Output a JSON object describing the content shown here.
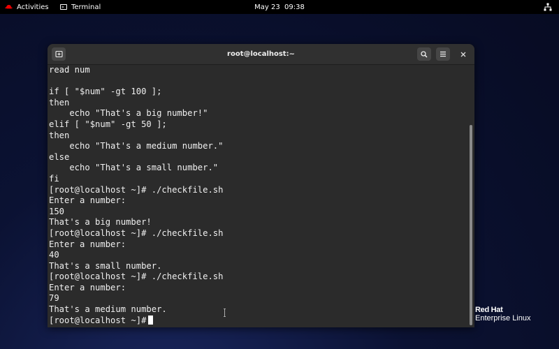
{
  "topbar": {
    "activities": "Activities",
    "app_name": "Terminal",
    "clock": "May 23  09:38"
  },
  "window": {
    "title": "root@localhost:~"
  },
  "terminal_lines": [
    "read num",
    "",
    "if [ \"$num\" -gt 100 ];",
    "then",
    "    echo \"That's a big number!\"",
    "elif [ \"$num\" -gt 50 ];",
    "then",
    "    echo \"That's a medium number.\"",
    "else",
    "    echo \"That's a small number.\"",
    "fi",
    "[root@localhost ~]# ./checkfile.sh",
    "Enter a number:",
    "150",
    "That's a big number!",
    "[root@localhost ~]# ./checkfile.sh",
    "Enter a number:",
    "40",
    "That's a small number.",
    "[root@localhost ~]# ./checkfile.sh",
    "Enter a number:",
    "79",
    "That's a medium number."
  ],
  "prompt": "[root@localhost ~]#",
  "branding": {
    "line1": "Red Hat",
    "line2": "Enterprise Linux"
  },
  "icons": {
    "new_tab": "new-tab-icon",
    "search": "search-icon",
    "menu": "hamburger-menu-icon",
    "close": "close-icon",
    "system": "network-icon"
  },
  "colors": {
    "topbar": "#000000",
    "terminal_bg": "#2b2b2b",
    "header_bg": "#303030",
    "text": "#f0f0f0",
    "redhat_red": "#ee0000"
  }
}
